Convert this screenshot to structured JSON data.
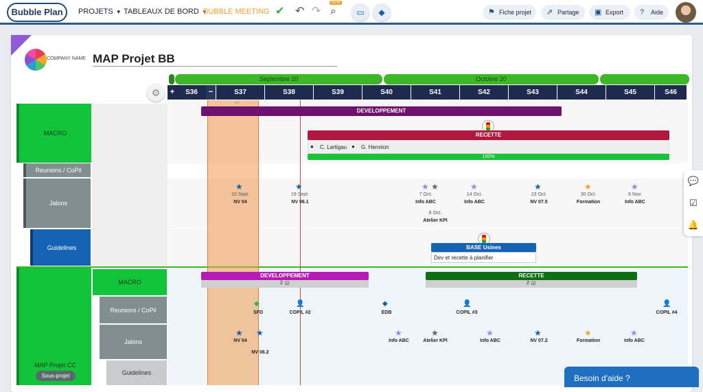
{
  "topbar": {
    "brand": "Bubble Plan",
    "menu": [
      "PROJETS",
      "TABLEAUX DE BORD",
      "BUBBLE MEETING"
    ],
    "new_badge": "NEW",
    "right_buttons": [
      "Fiche projet",
      "Partage",
      "Export",
      "Aide"
    ]
  },
  "header": {
    "company": "COMPANY NAME",
    "title": "MAP Projet BB"
  },
  "timeline": {
    "months": [
      "Septembre 20",
      "Octobre 20"
    ],
    "weeks": [
      "S36",
      "S37",
      "S38",
      "S39",
      "S40",
      "S41",
      "S42",
      "S43",
      "S44",
      "S45",
      "S46"
    ]
  },
  "rows": {
    "macro": "MACRO",
    "reunions": "Reunions / CoPil",
    "jalons": "Jalons",
    "guidelines": "Guidelines",
    "sub_macro": "MACRO",
    "sub_reunions": "Reunions / CoPil",
    "sub_jalons": "Jalons",
    "sub_guidelines": "Guidelines",
    "project_group": "MAP Projet CC",
    "subproject_tag": "Sous-projet"
  },
  "bars": {
    "dev": "DEVELOPPEMENT",
    "recette": "RECETTE",
    "people": [
      "C. Lartigau",
      "G. Hennion"
    ],
    "progress": "100%",
    "base_usines": "BASE Usines",
    "base_note": "Dev et recette à planifier",
    "sub_dev": "DEVELOPPEMENT",
    "sub_dev_count": "2",
    "sub_recette": "RECETTE",
    "sub_recette_count": "2"
  },
  "milestones": [
    {
      "date": "10 Sept.",
      "label": "NV 04"
    },
    {
      "date": "19 Sept.",
      "label": "NV 06.1"
    },
    {
      "date": "7 Oct.",
      "label": "Info ABC"
    },
    {
      "date": "8 Oct.",
      "label": "Atelier KPI"
    },
    {
      "date": "14 Oct.",
      "label": "Info ABC"
    },
    {
      "date": "23 Oct.",
      "label": "NV 07.5"
    },
    {
      "date": "30 Oct.",
      "label": "Formation"
    },
    {
      "date": "6 Nov.",
      "label": "Info ABC"
    }
  ],
  "sub_reunions": [
    "SFD",
    "COPIL #2",
    "EDB",
    "COPIL #3",
    "COPIL #4"
  ],
  "sub_jalons": [
    "NV 04",
    "NV 06.2",
    "Info ABC",
    "Atelier KPI",
    "Info ABC",
    "NV 07.2",
    "Formation",
    "Info ABC"
  ],
  "help": "Besoin d'aide ?",
  "colors": {
    "green": "#19c23a",
    "grey_row": "#7d8c8c",
    "blue_row": "#1a66b3",
    "purple": "#6f126f",
    "crimson": "#b0183f",
    "navy": "#1f2a4f"
  }
}
